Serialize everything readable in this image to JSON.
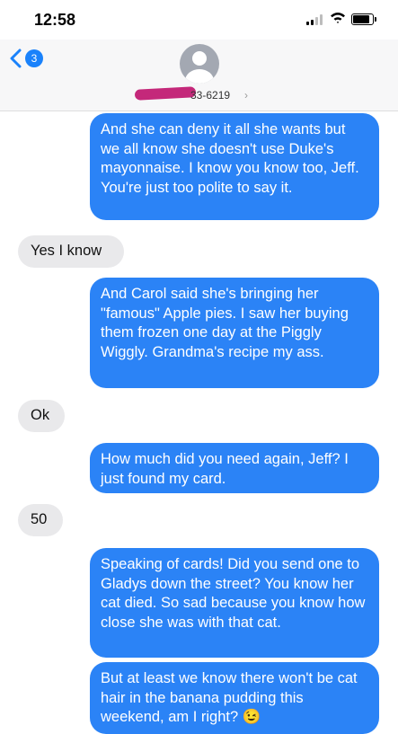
{
  "status": {
    "time": "12:58"
  },
  "nav": {
    "badge_count": "3",
    "contact_number": "33-6219",
    "chevron": "›"
  },
  "messages": [
    {
      "from": "me",
      "text": "And she can deny it all she wants but we all know she doesn't use Duke's mayonnaise. I know you know too, Jeff. You're just too polite to say it."
    },
    {
      "from": "them",
      "text": "Yes I know"
    },
    {
      "from": "me",
      "text": "And Carol said she's bringing her \"famous\" Apple pies. I saw her buying them frozen one day at the Piggly Wiggly. Grandma's recipe my ass."
    },
    {
      "from": "them",
      "text": "Ok"
    },
    {
      "from": "me",
      "text": "How much did you need again, Jeff? I just found my card."
    },
    {
      "from": "them",
      "text": "50"
    },
    {
      "from": "me",
      "text": "Speaking of cards! Did you send one to Gladys down the street? You know her cat died. So sad because you know how close she was with that cat."
    },
    {
      "from": "me",
      "text": "But at least we know there won't be cat hair in the banana pudding this weekend, am I right? 😉"
    }
  ],
  "colors": {
    "sent_bubble": "#2b83f6",
    "received_bubble": "#e9e9eb",
    "badge": "#1a82fb"
  }
}
